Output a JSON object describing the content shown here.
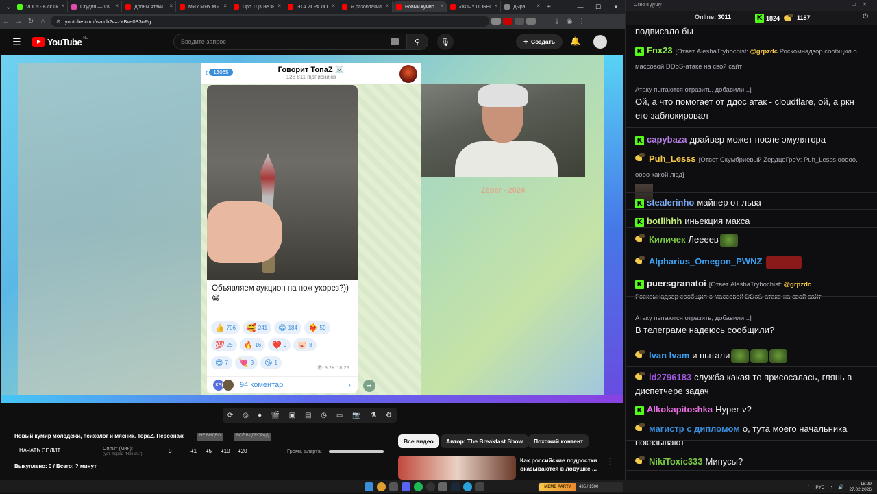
{
  "browser": {
    "tabs": [
      {
        "label": "VODs - Kick Dc",
        "color": "#53fc18"
      },
      {
        "label": "Студия — VK В",
        "color": "#e34cad"
      },
      {
        "label": "Дроны Атаки ...",
        "color": "#ff0000"
      },
      {
        "label": "МЯУ МЯУ МЯ",
        "color": "#ff0000"
      },
      {
        "label": "Про ТЦК не зна",
        "color": "#ff0000"
      },
      {
        "label": "ЭТА ИГРА ЛОМ",
        "color": "#ff0000"
      },
      {
        "label": "Я разоблачил л",
        "color": "#ff0000"
      },
      {
        "label": "Новый кумир м",
        "color": "#ff0000",
        "active": true
      },
      {
        "label": "«ХОЧУ ПОБЫ",
        "color": "#ff0000"
      },
      {
        "label": "Дыра",
        "color": "#888888"
      }
    ],
    "new_tab": "+",
    "url": "youtube.com/watch?v=zYBve0B3oRg"
  },
  "youtube": {
    "logo_text": "YouTube",
    "region": "RU",
    "search_placeholder": "Введите запрос",
    "create_label": "Создать"
  },
  "telegram": {
    "back_count": "13065",
    "channel_title": "Говорит ТопаZ ☠️",
    "subscribers": "128 811 підписників",
    "message_text": "Объявляем аукцион на нож ухорез?))",
    "message_emoji": "😁",
    "reactions": [
      {
        "emoji": "👍",
        "count": "706"
      },
      {
        "emoji": "🥰",
        "count": "241"
      },
      {
        "emoji": "😁",
        "count": "184"
      },
      {
        "emoji": "❤️‍🔥",
        "count": "59"
      },
      {
        "emoji": "💯",
        "count": "25"
      },
      {
        "emoji": "🔥",
        "count": "16"
      },
      {
        "emoji": "❤️",
        "count": "9"
      },
      {
        "emoji": "🐷",
        "count": "8"
      },
      {
        "emoji": "😍",
        "count": "7"
      },
      {
        "emoji": "💘",
        "count": "3"
      },
      {
        "emoji": "😘",
        "count": "1"
      }
    ],
    "views_time": "👁 9,2K 18:29",
    "comments_avatar": "KS",
    "comments_label": "94 коментарі"
  },
  "watermark": "Zeper - 2024",
  "video": {
    "title": "Новый кумир молодежи, психолог и мясник. TopaZ. Персонаж",
    "pill1": "НЕ ВИДЕО",
    "pill2": "ВСЁ ВИДЕОРАД",
    "split_button": "НАЧАТЬ СПЛИТ",
    "split_label": "Сплит (мин):",
    "split_hint": "(уст. перед \"Начать\")",
    "split_value": "0",
    "increments": [
      "+1",
      "+5",
      "+10",
      "+20"
    ],
    "alert_label": "Громк. алерта:",
    "alert_volume": 1.0,
    "bought": "Выкуплено: 0 / Всего: ? минут"
  },
  "filters": {
    "all": "Все видео",
    "author": "Автор: The Breakfast Show",
    "related": "Похожий контент"
  },
  "recommendation": {
    "title": "Как российские подростки оказываются в ловушке ..."
  },
  "chat": {
    "window_title": "Окно в душу",
    "online_label": "Online:",
    "online_count": "3011",
    "kick_count": "1824",
    "yt_count": "1187",
    "messages": [
      {
        "text": "подвисало бы"
      },
      {
        "platform": "kick",
        "user": "Fnx23",
        "color": "#8be94a",
        "reply": "[Ответ AleshaTrybochist: ",
        "reply_user": "@grpzdc",
        "reply_rest": " Роскомнадзор сообщил о массовой DDoS-атаке на свой сайт",
        "extra": "Атаку пытаются отразить, добавили...]",
        "text": "Ой, а что помогает от ддос атак - cloudflare, ой, а ркн его заблокировал"
      },
      {
        "platform": "kick",
        "user": "capybaza",
        "color": "#b87ee8",
        "text": "драйвер может после эмулятора"
      },
      {
        "platform": "yt",
        "user": "Puh_Lesss",
        "color": "#f7c948",
        "reply": "[Ответ Скумбриевый ZердцеГреV: Puh_Lesss ооооо, оооо какой люд]"
      },
      {
        "platform": "kick",
        "user": "stealerinho",
        "color": "#7aa8f0",
        "text": "майнер от льва"
      },
      {
        "platform": "kick",
        "user": "botlihhh",
        "color": "#c6f07a",
        "text": "иньекция макса"
      },
      {
        "platform": "yt",
        "user": "Киличек",
        "color": "#7ac943",
        "text": "Лееeев"
      },
      {
        "platform": "yt",
        "user": "Alpharius_Omegon_PWNZ",
        "color": "#3aa0f0",
        "text": ""
      },
      {
        "platform": "kick",
        "user": "puersgranatoi",
        "color": "#e7e7e7",
        "reply": "[Ответ AleshaTrybochist: ",
        "reply_user": "@grpzdc",
        "reply_rest": "",
        "sub": "Роскомнадзор сообщил о массовой DDoS-атаке на свой сайт",
        "extra": "Атаку пытаются отразить, добавили...]",
        "text": "В телеграме надеюсь сообщили?"
      },
      {
        "platform": "yt",
        "user": "Ivan Ivam",
        "color": "#3aa0f0",
        "text": "и пытали"
      },
      {
        "platform": "yt",
        "user": "id2796183",
        "color": "#a05ae0",
        "text": "служба какая-то присосалась, глянь в диспетчере задач"
      },
      {
        "platform": "kick",
        "user": "Alkokapitoshka",
        "color": "#e96ee0",
        "text": "Hyper-v?"
      },
      {
        "platform": "yt",
        "user": "магистр с дипломом",
        "color": "#3a8edb",
        "text": "о, тута моего начальника показывают"
      },
      {
        "platform": "yt",
        "user": "NikiToxic333",
        "color": "#7ac943",
        "text": "Минусы?"
      }
    ]
  },
  "taskbar": {
    "media_title": "MEME PARTY",
    "media_progress": "435 / 1500",
    "lang": "РУС",
    "time": "18:29",
    "date": "27.02.2026"
  }
}
